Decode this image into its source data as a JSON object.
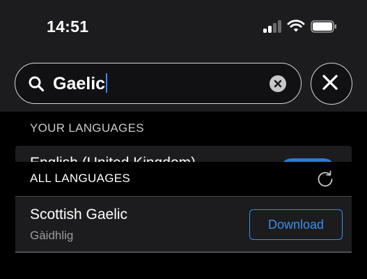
{
  "status_bar": {
    "time": "14:51"
  },
  "search": {
    "query": "Gaelic",
    "icons": {
      "search": "search-icon",
      "clear": "clear-icon",
      "close": "close-icon"
    }
  },
  "your_languages": {
    "header": "YOUR LANGUAGES",
    "items": [
      {
        "label": "English (United Kingdom)",
        "enabled": true
      }
    ]
  },
  "all_languages": {
    "header": "ALL LANGUAGES",
    "refresh_icon": "refresh-icon",
    "items": [
      {
        "name": "Scottish Gaelic",
        "native": "Gàidhlig",
        "action": "Download"
      }
    ]
  },
  "colors": {
    "accent": "#3a8eea",
    "toggle_on": "#2f78d8",
    "background": "#000000",
    "surface": "#1c1c1e"
  }
}
